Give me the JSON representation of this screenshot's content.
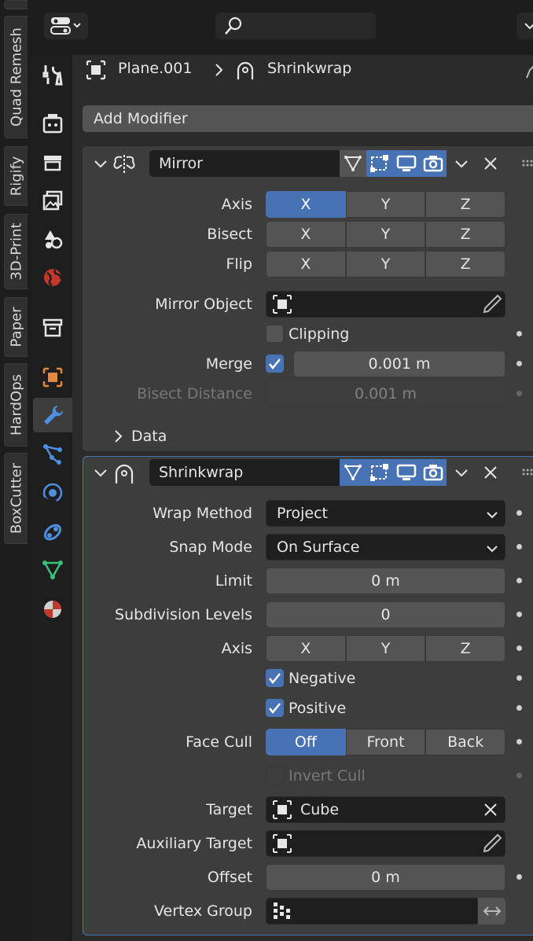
{
  "vertical_tabs": [
    "Quad Remesh",
    "Rigify",
    "3D-Print",
    "Paper",
    "HardOps",
    "BoxCutter"
  ],
  "icon_column": [
    "tool-icon",
    "render-icon",
    "output-icon",
    "view-layer-icon",
    "scene-icon",
    "world-icon",
    "collection-icon",
    "object-icon",
    "modifier-icon",
    "particles-icon",
    "physics-icon",
    "constraints-icon",
    "data-icon",
    "material-icon"
  ],
  "breadcrumb": {
    "object": "Plane.001",
    "modifier": "Shrinkwrap"
  },
  "add_modifier": "Add Modifier",
  "mirror": {
    "name": "Mirror",
    "axis_label": "Axis",
    "bisect_label": "Bisect",
    "flip_label": "Flip",
    "x": "X",
    "y": "Y",
    "z": "Z",
    "mirror_object_label": "Mirror Object",
    "clipping_label": "Clipping",
    "merge_label": "Merge",
    "merge_value": "0.001 m",
    "bisect_distance_label": "Bisect Distance",
    "bisect_distance_value": "0.001 m",
    "data_label": "Data"
  },
  "shrinkwrap": {
    "name": "Shrinkwrap",
    "wrap_method_label": "Wrap Method",
    "wrap_method_value": "Project",
    "snap_mode_label": "Snap Mode",
    "snap_mode_value": "On Surface",
    "limit_label": "Limit",
    "limit_value": "0 m",
    "subdiv_label": "Subdivision Levels",
    "subdiv_value": "0",
    "axis_label": "Axis",
    "x": "X",
    "y": "Y",
    "z": "Z",
    "negative_label": "Negative",
    "positive_label": "Positive",
    "face_cull_label": "Face Cull",
    "cull_off": "Off",
    "cull_front": "Front",
    "cull_back": "Back",
    "invert_cull_label": "Invert Cull",
    "target_label": "Target",
    "target_value": "Cube",
    "aux_target_label": "Auxiliary Target",
    "offset_label": "Offset",
    "offset_value": "0 m",
    "vertex_group_label": "Vertex Group"
  },
  "colors": {
    "accent": "#4772b3",
    "panel": "#3d3d3d",
    "field": "#545454"
  }
}
